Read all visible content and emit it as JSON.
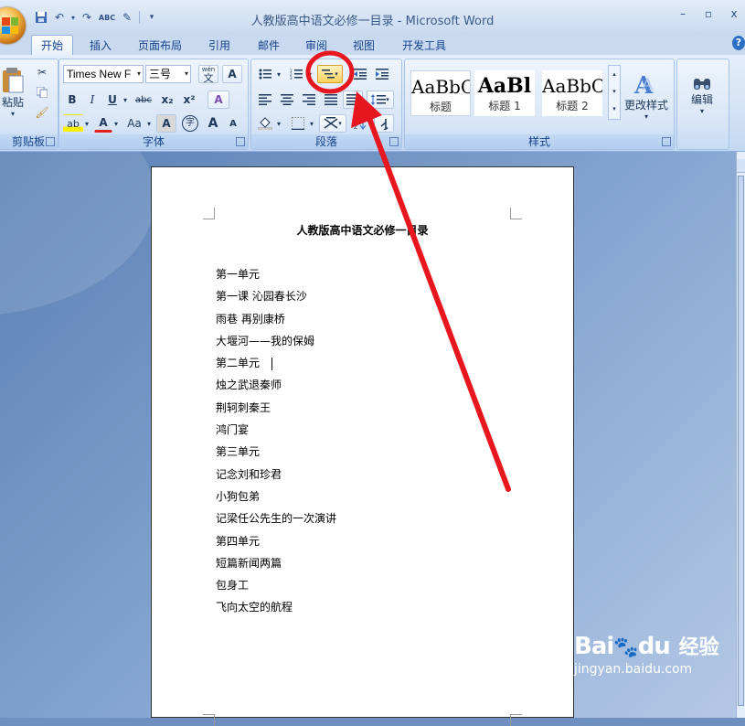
{
  "app": {
    "window_title": "人教版高中语文必修一目录 - Microsoft Word",
    "qat": {
      "save": "💾",
      "undo": "↶",
      "redo": "↷",
      "spell": "ABC",
      "format": "✎",
      "more": "▾"
    },
    "window_controls": {
      "minimize": "–",
      "maximize": "▫",
      "close": "x"
    }
  },
  "tabs": [
    {
      "label": "开始"
    },
    {
      "label": "插入"
    },
    {
      "label": "页面布局"
    },
    {
      "label": "引用"
    },
    {
      "label": "邮件"
    },
    {
      "label": "审阅"
    },
    {
      "label": "视图"
    },
    {
      "label": "开发工具"
    }
  ],
  "ribbon": {
    "clipboard": {
      "label": "剪贴板",
      "paste": "粘贴"
    },
    "font": {
      "label": "字体",
      "font_name": "Times New F",
      "font_size": "三号",
      "wen": "wén",
      "boxed_a": "A",
      "bold": "B",
      "italic": "I",
      "underline": "U",
      "strike": "abc",
      "sub": "x₂",
      "sup": "x²",
      "clear": "A",
      "highlight": "ab",
      "color": "A",
      "case": "Aa",
      "shade": "A",
      "enclose": "字",
      "grow": "A",
      "shrink": "A"
    },
    "paragraph": {
      "label": "段落"
    },
    "styles": {
      "label": "样式",
      "items": [
        {
          "sample": "AaBbC",
          "name": "标题"
        },
        {
          "sample": "AaBl",
          "name": "标题 1"
        },
        {
          "sample": "AaBbC",
          "name": "标题 2"
        }
      ],
      "change_styles": "更改样式"
    },
    "editing": {
      "label": "编辑"
    }
  },
  "document": {
    "heading": "人教版高中语文必修一目录",
    "lines": [
      "第一单元",
      "第一课  沁园春长沙",
      "雨巷  再别康桥",
      "大堰河——我的保姆",
      "第二单元",
      "烛之武退秦师",
      "荆轲刺秦王",
      "鸿门宴",
      "第三单元",
      "记念刘和珍君",
      "小狗包弟",
      "记梁任公先生的一次演讲",
      "第四单元",
      "短篇新闻两篇",
      "包身工",
      "飞向太空的航程"
    ]
  },
  "colors": {
    "annotation": "#e8171f",
    "ribbon": "#d3e2f5",
    "workspace": "#6e8fbf"
  },
  "watermark": {
    "brand": "Bai",
    "paw": "🐾",
    "brand2": "du",
    "cn": "经验",
    "url": "jingyan.baidu.com"
  }
}
